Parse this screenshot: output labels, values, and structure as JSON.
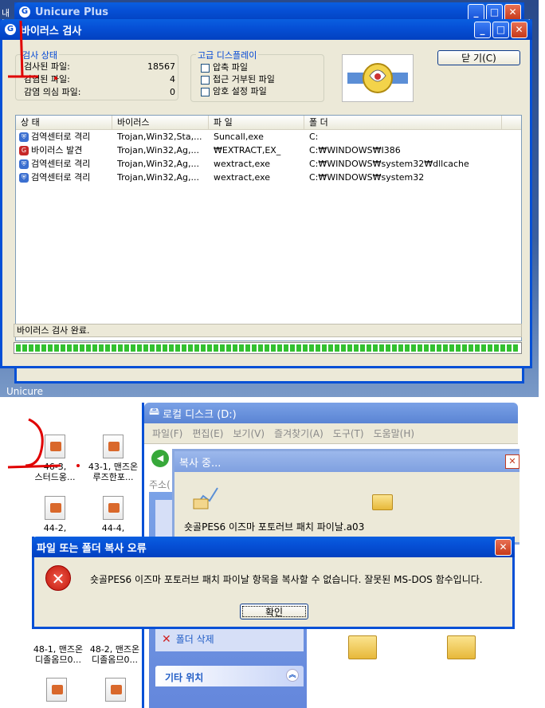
{
  "bg_window": {
    "title": "Unicure Plus",
    "label": "Unicure",
    "left_char": "내"
  },
  "scan_dialog": {
    "title": "바이러스 검사",
    "status_group": {
      "legend": "검사 상태",
      "rows": [
        {
          "label": "검사된 파일:",
          "value": "18567"
        },
        {
          "label": "감염된 파일:",
          "value": "4"
        },
        {
          "label": "감염 의심 파일:",
          "value": "0"
        }
      ]
    },
    "display_group": {
      "legend": "고급 디스플레이",
      "options": [
        "압축 파일",
        "접근 거부된 파일",
        "암호 설정 파일"
      ]
    },
    "close_button": "닫 기(C)",
    "columns": [
      "상 태",
      "바이러스",
      "파 일",
      "폴 더"
    ],
    "rows": [
      {
        "status": "검역센터로 격리",
        "virus": "Trojan,Win32,Sta,...",
        "file": "Suncall,exe",
        "folder": "C:"
      },
      {
        "status": "바이러스 발견",
        "virus": "Trojan,Win32,Ag,...",
        "file": "₩EXTRACT,EX_",
        "folder": "C:₩WINDOWS₩I386"
      },
      {
        "status": "검역센터로 격리",
        "virus": "Trojan,Win32,Ag,...",
        "file": "wextract,exe",
        "folder": "C:₩WINDOWS₩system32₩dllcache"
      },
      {
        "status": "검역센터로 격리",
        "virus": "Trojan,Win32,Ag,...",
        "file": "wextract,exe",
        "folder": "C:₩WINDOWS₩system32"
      }
    ],
    "status_text": "바이러스 검사 완료.",
    "progress": 1.0
  },
  "explorer": {
    "title": "로컬 디스크 (D:)",
    "menu": [
      "파일(F)",
      "편집(E)",
      "보기(V)",
      "즐겨찾기(A)",
      "도구(T)",
      "도움말(H)"
    ],
    "address_label": "주소(",
    "panel_item": "폴더 삭제",
    "panel_section": "기타 위치",
    "desktop_icons": [
      {
        "line1": "46-3,",
        "line2": "스터드옹..."
      },
      {
        "line1": "43-1, 맨즈온",
        "line2": "루즈한포..."
      },
      {
        "line1": "44-2,",
        "line2": "..."
      },
      {
        "line1": "44-4,",
        "line2": "..."
      },
      {
        "line1": "48-1, 맨즈온",
        "line2": "디졸옴므0..."
      },
      {
        "line1": "48-2, 맨즈온",
        "line2": "디졸옴므0..."
      }
    ]
  },
  "copy_dialog": {
    "title": "복사 중...",
    "filename": "숏골PES6 이즈마 포토러브 패치 파이날.a03"
  },
  "error_dialog": {
    "title": "파일 또는 폴더 복사 오류",
    "message": "숏골PES6 이즈마 포토러브 패치 파이날 항목을 복사할 수 없습니다. 잘못된 MS-DOS 함수입니다.",
    "ok_button": "확인"
  }
}
